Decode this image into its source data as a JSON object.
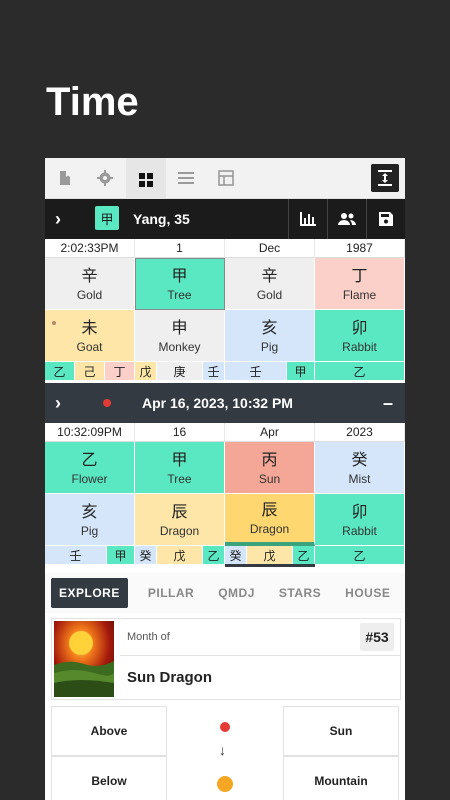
{
  "page_title": "Time",
  "toolbar": {
    "icons": [
      "book-icon",
      "gear-icon",
      "grid-icon",
      "list-icon",
      "table-icon",
      "expand-icon"
    ]
  },
  "chart1": {
    "badge": "甲",
    "label": "Yang, 35",
    "headers": [
      "2:02:33PM",
      "1",
      "Dec",
      "1987"
    ],
    "stems": [
      {
        "cn": "辛",
        "en": "Gold"
      },
      {
        "cn": "甲",
        "en": "Tree"
      },
      {
        "cn": "辛",
        "en": "Gold"
      },
      {
        "cn": "丁",
        "en": "Flame"
      }
    ],
    "branches": [
      {
        "cn": "未",
        "en": "Goat"
      },
      {
        "cn": "申",
        "en": "Monkey"
      },
      {
        "cn": "亥",
        "en": "Pig"
      },
      {
        "cn": "卯",
        "en": "Rabbit"
      }
    ],
    "hidden": [
      [
        "乙",
        "己",
        "丁"
      ],
      [
        "戊",
        "庚",
        "壬"
      ],
      [
        "壬",
        "甲"
      ],
      [
        "乙"
      ]
    ]
  },
  "chart2": {
    "datetime": "Apr 16, 2023, 10:32 PM",
    "headers": [
      "10:32:09PM",
      "16",
      "Apr",
      "2023"
    ],
    "stems": [
      {
        "cn": "乙",
        "en": "Flower"
      },
      {
        "cn": "甲",
        "en": "Tree"
      },
      {
        "cn": "丙",
        "en": "Sun"
      },
      {
        "cn": "癸",
        "en": "Mist"
      }
    ],
    "branches": [
      {
        "cn": "亥",
        "en": "Pig"
      },
      {
        "cn": "辰",
        "en": "Dragon"
      },
      {
        "cn": "辰",
        "en": "Dragon"
      },
      {
        "cn": "卯",
        "en": "Rabbit"
      }
    ],
    "hidden": [
      [
        "壬",
        "甲"
      ],
      [
        "癸",
        "戊",
        "乙"
      ],
      [
        "癸",
        "戊",
        "乙"
      ],
      [
        "乙"
      ]
    ]
  },
  "tabs": [
    "EXPLORE",
    "PILLAR",
    "QMDJ",
    "STARS",
    "HOUSE"
  ],
  "card": {
    "label": "Month of",
    "name": "Sun Dragon",
    "number": "#53"
  },
  "relation": {
    "above": "Above",
    "below": "Below",
    "top_right": "Sun",
    "bottom_right": "Mountain",
    "arrow": "↓"
  },
  "colors": {
    "wood": "#5ae8c3",
    "metal": "#efefef",
    "fire_light": "#fbd0c9",
    "earth": "#fde6a8",
    "water": "#d5e6fb",
    "fire": "#f5a797",
    "earth_strong": "#ffd770",
    "accent_red": "#e53935",
    "accent_orange": "#f5a623"
  }
}
